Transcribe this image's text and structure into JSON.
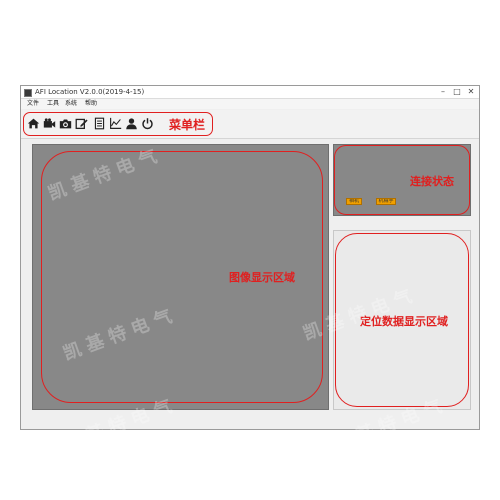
{
  "window": {
    "title": "AFI Location V2.0.0(2019-4-15)",
    "min_glyph": "–",
    "max_glyph": "□",
    "close_glyph": "✕"
  },
  "menubar": {
    "items": [
      "文件",
      "工具",
      "系统",
      "帮助"
    ]
  },
  "toolbar": {
    "caption": "菜单栏",
    "icons": [
      "home-icon",
      "video-camera-icon",
      "camera-icon",
      "edit-icon",
      "document-icon",
      "chart-icon",
      "user-icon",
      "power-icon"
    ]
  },
  "image_area": {
    "caption": "图像显示区域"
  },
  "connection_panel": {
    "caption": "连接状态",
    "indicators": [
      {
        "label": "相机",
        "color": "#f0a000"
      },
      {
        "label": "机械手",
        "color": "#f0a000"
      }
    ]
  },
  "data_panel": {
    "caption": "定位数据显示区域"
  },
  "watermark": {
    "text": "凯基特电气"
  },
  "colors": {
    "annotation_red": "#e02020",
    "display_gray": "#888888",
    "indicator_orange": "#f0a000"
  }
}
